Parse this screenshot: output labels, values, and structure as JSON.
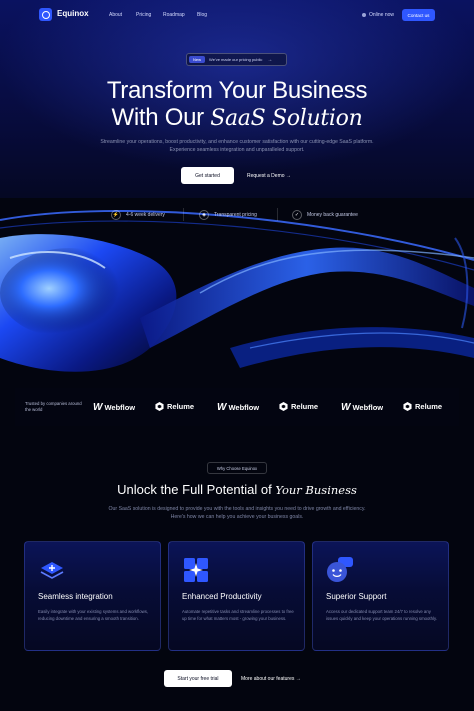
{
  "nav": {
    "brand": "Equinox",
    "links": [
      "About",
      "Pricing",
      "Roadmap",
      "Blog"
    ],
    "status": "Online now",
    "contact_label": "Contact us"
  },
  "hero": {
    "pill_badge": "New",
    "pill_text": "We've made our pricing public",
    "headline_line1": "Transform Your Business",
    "headline_line2_plain": "With Our",
    "headline_line2_italic": "SaaS Solution",
    "subtext": "Streamline your operations, boost productivity, and enhance customer satisfaction with our cutting-edge SaaS platform. Experience seamless integration and unparalleled support.",
    "primary_cta": "Get started",
    "secondary_cta": "Request a Demo →",
    "features": [
      {
        "icon": "lightning-icon",
        "label": "4-6 week delivery"
      },
      {
        "icon": "tag-icon",
        "label": "Transparent pricing"
      },
      {
        "icon": "shield-check-icon",
        "label": "Money back guarantee"
      }
    ]
  },
  "trust": {
    "label": "Trusted by companies around the world",
    "logos": [
      "Webflow",
      "Relume",
      "Webflow",
      "Relume",
      "Webflow",
      "Relume"
    ]
  },
  "why": {
    "pill": "Why Choose Equinox",
    "title_plain": "Unlock the Full Potential of",
    "title_italic": "Your Business",
    "subtext": "Our SaaS solution is designed to provide you with the tools and insights you need to drive growth and efficiency. Here's how we can help you achieve your business goals.",
    "cards": [
      {
        "icon": "stack-plus-icon",
        "title": "Seamless integration",
        "text": "Easily integrate with your existing systems and workflows, reducing downtime and ensuring a smooth transition."
      },
      {
        "icon": "grid-sparkle-icon",
        "title": "Enhanced Productivity",
        "text": "Automate repetitive tasks and streamline processes to free up time for what matters most - growing your business."
      },
      {
        "icon": "support-chat-icon",
        "title": "Superior Support",
        "text": "Access our dedicated support team 24/7 to resolve any issues quickly and keep your operations running smoothly."
      }
    ],
    "primary_cta": "Start your free trial",
    "secondary_cta": "More about our features →"
  },
  "colors": {
    "accent": "#2f57ff",
    "background": "#03050f",
    "hero_glow": "#0a1260"
  }
}
